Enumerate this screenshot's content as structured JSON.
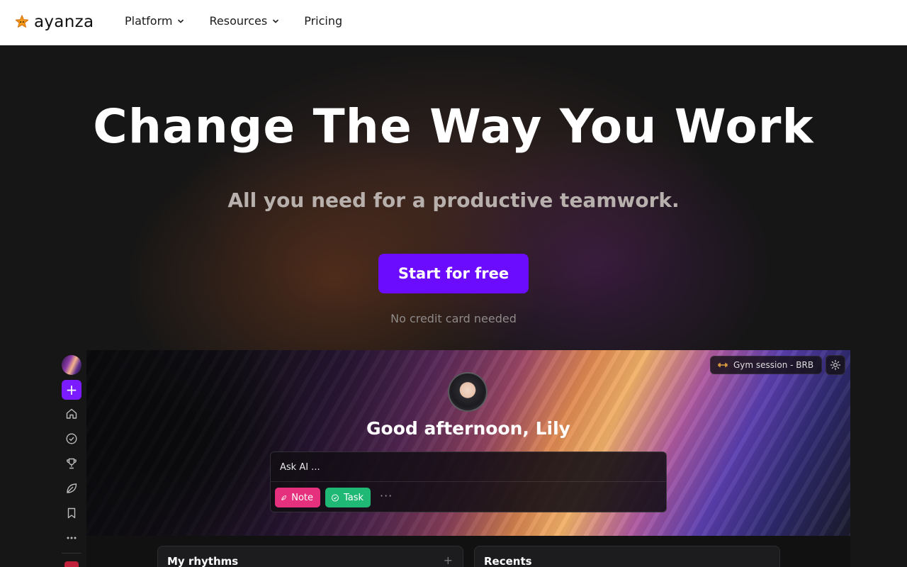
{
  "brand": {
    "name": "ayanza",
    "accent": "#6b0cff"
  },
  "nav": {
    "items": [
      {
        "label": "Platform",
        "has_dropdown": true
      },
      {
        "label": "Resources",
        "has_dropdown": true
      },
      {
        "label": "Pricing",
        "has_dropdown": false
      }
    ]
  },
  "hero": {
    "title": "Change The Way You Work",
    "subtitle": "All you need for a productive teamwork.",
    "cta_label": "Start for free",
    "cta_note": "No credit card needed"
  },
  "app_preview": {
    "sidebar": {
      "add_label": "+",
      "icons": [
        "home-icon",
        "check-circle-icon",
        "trophy-icon",
        "leaf-icon",
        "bookmark-icon",
        "more-icon"
      ]
    },
    "status": {
      "emoji_icon": "dumbbell-icon",
      "text": "Gym session - BRB"
    },
    "greeting": "Good afternoon, Lily",
    "ask_placeholder": "Ask AI ...",
    "chips": [
      {
        "label": "Note",
        "icon": "feather-icon",
        "color": "#e5307d"
      },
      {
        "label": "Task",
        "icon": "check-circle-icon",
        "color": "#1fb874"
      }
    ],
    "more_label": "···",
    "panels": [
      {
        "title": "My rhythms",
        "action": "+"
      },
      {
        "title": "Recents"
      }
    ]
  }
}
